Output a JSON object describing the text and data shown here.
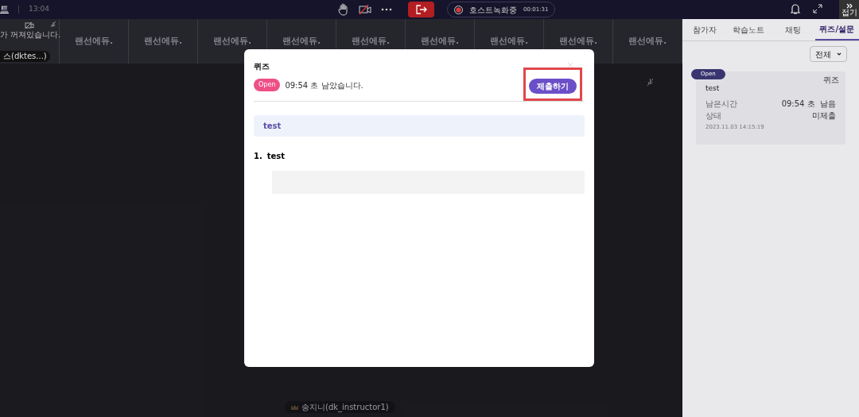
{
  "top_bar": {
    "title": "트",
    "time": "13:04",
    "recording": {
      "label": "호스트녹화중",
      "time": "00:01:31"
    },
    "collapse_label": "접기"
  },
  "video_strip": {
    "first_tile": {
      "message": "가 꺼져있습니다.",
      "name": "스(dktes...)"
    },
    "tiles": [
      "랜선에듀.",
      "랜선에듀.",
      "랜선에듀.",
      "랜선에듀.",
      "랜선에듀.",
      "랜선에듀.",
      "랜선에듀.",
      "랜선에듀.",
      "랜선에듀."
    ]
  },
  "speaker_name": "송지니(dk_instructor1)",
  "quiz_modal": {
    "title": "퀴즈",
    "status": "Open",
    "remaining": "09:54 초 남았습니다.",
    "submit": "제출하기",
    "highlighted": true,
    "quiz_title": "test",
    "questions": [
      {
        "number": "1.",
        "text": "test"
      }
    ]
  },
  "side_panel": {
    "tabs": [
      {
        "label": "참가자",
        "selected": false
      },
      {
        "label": "학습노트",
        "selected": false
      },
      {
        "label": "채팅",
        "selected": false
      },
      {
        "label": "퀴즈/설문",
        "selected": true
      }
    ],
    "filter": "전체",
    "cards": [
      {
        "status": "Open",
        "type": "퀴즈",
        "title": "test",
        "remaining_label": "남은시간",
        "remaining_value": "09:54 초  남음",
        "state_label": "상태",
        "state_value": "미제출",
        "date": "2023.11.03 14:15:19"
      }
    ]
  }
}
